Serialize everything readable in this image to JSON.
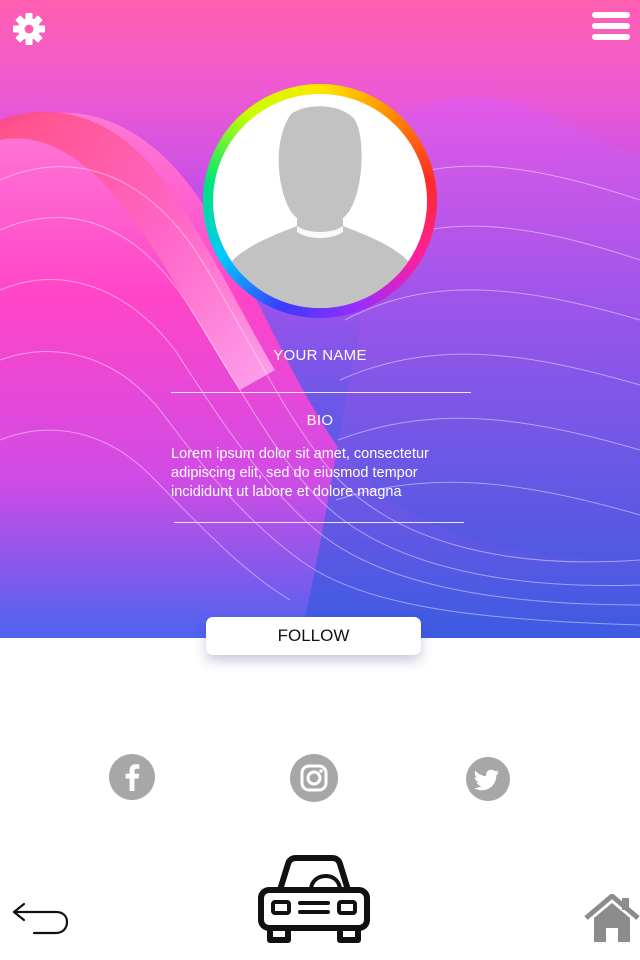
{
  "header": {
    "settings_icon": "gear-icon",
    "menu_icon": "hamburger-menu-icon"
  },
  "profile": {
    "avatar_icon": "default-user-avatar-icon",
    "name_label": "YOUR NAME",
    "name_value": "",
    "bio_label": "BIO",
    "bio_text": "Lorem ipsum dolor sit amet, consectetur adipiscing elit, sed do eiusmod tempor incididunt ut labore et dolore magna"
  },
  "follow_label": "FOLLOW",
  "social": [
    {
      "name": "facebook-icon"
    },
    {
      "name": "instagram-icon"
    },
    {
      "name": "twitter-icon"
    }
  ],
  "bottom_nav": {
    "back_icon": "back-arrow-icon",
    "center_icon": "car-icon",
    "home_icon": "home-icon"
  },
  "colors": {
    "hero_top": "#ff5fb0",
    "hero_mid": "#9e52ea",
    "hero_bottom": "#3157d6",
    "social_gray": "#a7a7a7"
  }
}
